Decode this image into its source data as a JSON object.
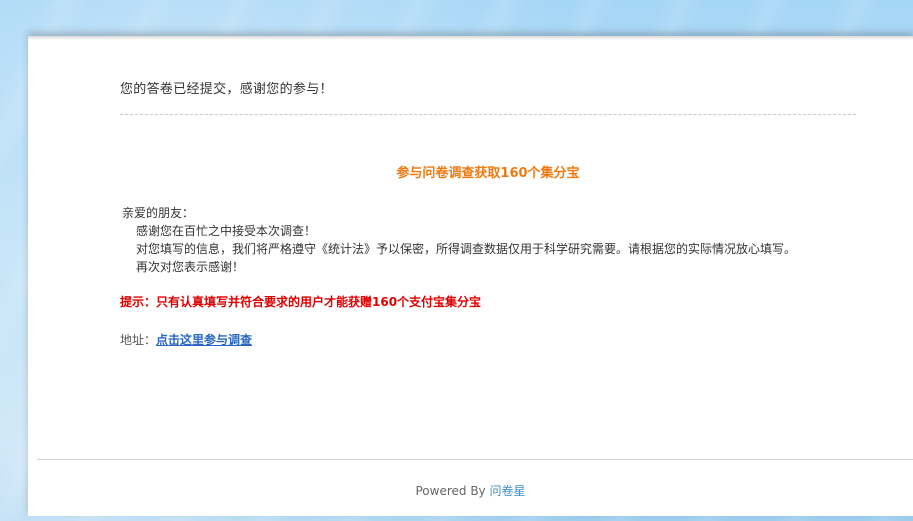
{
  "confirmation": {
    "message": "您的答卷已经提交，感谢您的参与！"
  },
  "promo": {
    "title": "参与问卷调查获取160个集分宝"
  },
  "letter": {
    "greeting": "亲爱的朋友：",
    "lines": [
      "感谢您在百忙之中接受本次调查！",
      "对您填写的信息，我们将严格遵守《统计法》予以保密，所得调查数据仅用于科学研究需要。请根据您的实际情况放心填写。",
      "再次对您表示感谢！"
    ]
  },
  "tip": {
    "text": "提示：只有认真填写并符合要求的用户才能获赠160个支付宝集分宝"
  },
  "address": {
    "label": "地址：",
    "link_text": "点击这里参与调查"
  },
  "footer": {
    "powered_by": "Powered By",
    "brand_link": "问卷星"
  },
  "colors": {
    "promo_title": "#f07a10",
    "tip": "#e00000",
    "link": "#2a67c2",
    "brand_link": "#3a8fd0",
    "background": "#a9d4f1"
  }
}
